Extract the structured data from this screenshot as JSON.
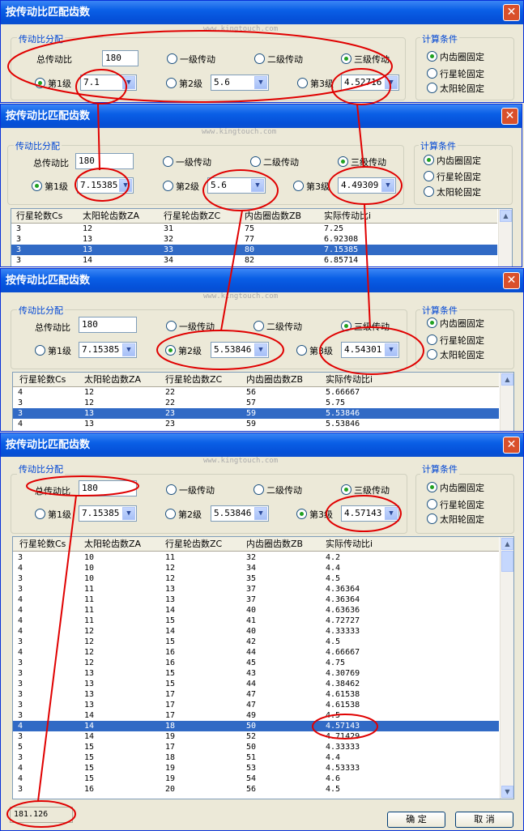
{
  "title": "按传动比匹配齿数",
  "close": "✕",
  "watermark": "www.kingtouch.com",
  "group_ratio": "传动比分配",
  "group_calc": "计算条件",
  "total_label": "总传动比",
  "total_value": "180",
  "opt1": "一级传动",
  "opt2": "二级传动",
  "opt3": "三级传动",
  "stage1": "第1级",
  "stage2": "第2级",
  "stage3": "第3级",
  "calc1": "内齿圈固定",
  "calc2": "行星轮固定",
  "calc3": "太阳轮固定",
  "columns": [
    "行星轮数Cs",
    "太阳轮齿数ZA",
    "行星轮齿数ZC",
    "内齿圈齿数ZB",
    "实际传动比i"
  ],
  "panels": [
    {
      "s1": "7.1",
      "s2": "5.6",
      "s3": "4.52716"
    },
    {
      "s1": "7.15385",
      "s2": "5.6",
      "s3": "4.49309",
      "rows": [
        [
          "3",
          "12",
          "31",
          "75",
          "7.25"
        ],
        [
          "3",
          "13",
          "32",
          "77",
          "6.92308"
        ],
        [
          "3",
          "13",
          "33",
          "80",
          "7.15385"
        ],
        [
          "3",
          "14",
          "34",
          "82",
          "6.85714"
        ]
      ]
    },
    {
      "s1": "7.15385",
      "s2": "5.53846",
      "s3": "4.54301",
      "rows": [
        [
          "4",
          "12",
          "22",
          "56",
          "5.66667"
        ],
        [
          "3",
          "12",
          "22",
          "57",
          "5.75"
        ],
        [
          "3",
          "13",
          "23",
          "59",
          "5.53846"
        ],
        [
          "4",
          "13",
          "23",
          "59",
          "5.53846"
        ]
      ]
    },
    {
      "s1": "7.15385",
      "s2": "5.53846",
      "s3": "4.57143",
      "rows": [
        [
          "3",
          "10",
          "11",
          "32",
          "4.2"
        ],
        [
          "4",
          "10",
          "12",
          "34",
          "4.4"
        ],
        [
          "3",
          "10",
          "12",
          "35",
          "4.5"
        ],
        [
          "3",
          "11",
          "13",
          "37",
          "4.36364"
        ],
        [
          "4",
          "11",
          "13",
          "37",
          "4.36364"
        ],
        [
          "4",
          "11",
          "14",
          "40",
          "4.63636"
        ],
        [
          "4",
          "11",
          "15",
          "41",
          "4.72727"
        ],
        [
          "4",
          "12",
          "14",
          "40",
          "4.33333"
        ],
        [
          "3",
          "12",
          "15",
          "42",
          "4.5"
        ],
        [
          "4",
          "12",
          "16",
          "44",
          "4.66667"
        ],
        [
          "3",
          "12",
          "16",
          "45",
          "4.75"
        ],
        [
          "3",
          "13",
          "15",
          "43",
          "4.30769"
        ],
        [
          "3",
          "13",
          "15",
          "44",
          "4.38462"
        ],
        [
          "3",
          "13",
          "17",
          "47",
          "4.61538"
        ],
        [
          "3",
          "13",
          "17",
          "47",
          "4.61538"
        ],
        [
          "3",
          "14",
          "17",
          "49",
          "4.5"
        ],
        [
          "4",
          "14",
          "18",
          "50",
          "4.57143"
        ],
        [
          "3",
          "14",
          "19",
          "52",
          "4.71429"
        ],
        [
          "5",
          "15",
          "17",
          "50",
          "4.33333"
        ],
        [
          "3",
          "15",
          "18",
          "51",
          "4.4"
        ],
        [
          "4",
          "15",
          "19",
          "53",
          "4.53333"
        ],
        [
          "4",
          "15",
          "19",
          "54",
          "4.6"
        ],
        [
          "3",
          "16",
          "20",
          "56",
          "4.5"
        ]
      ]
    }
  ],
  "status_value": "181.126",
  "ok_button": "确  定",
  "cancel_button": "取  消"
}
